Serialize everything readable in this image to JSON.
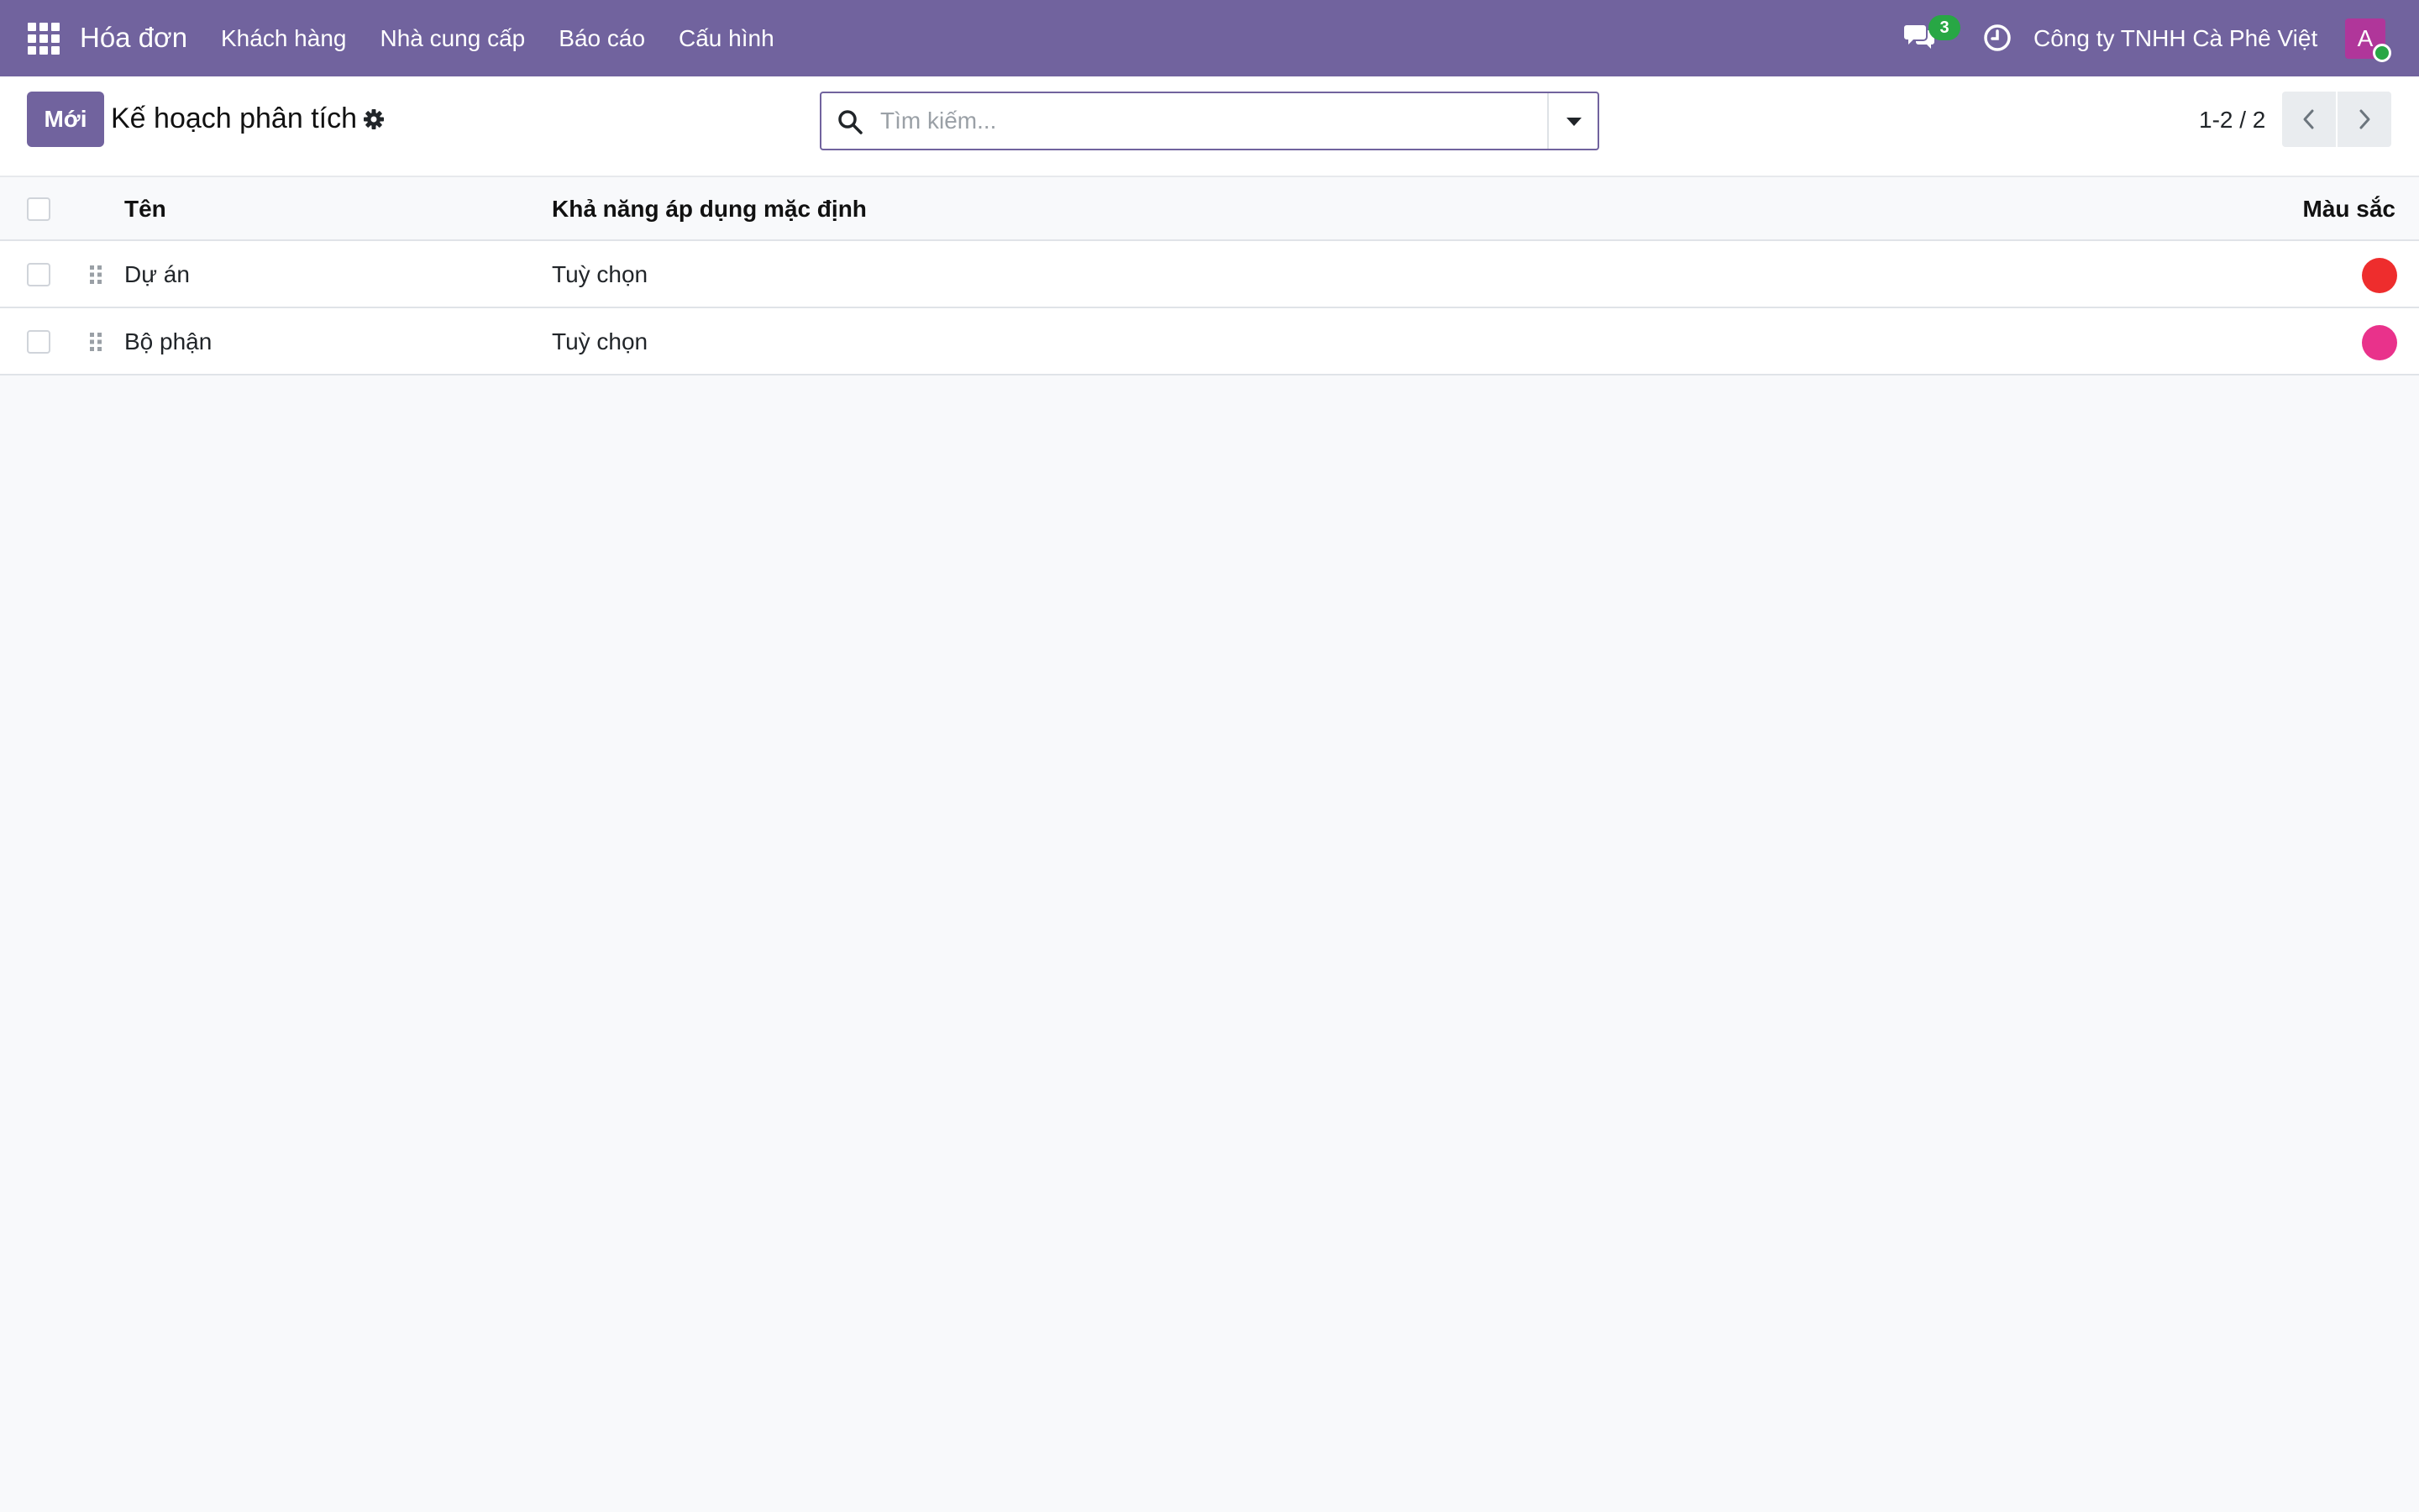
{
  "navbar": {
    "app_title": "Hóa đơn",
    "menu": [
      "Khách hàng",
      "Nhà cung cấp",
      "Báo cáo",
      "Cấu hình"
    ],
    "chat_count": "3",
    "company": "Công ty TNHH Cà Phê Việt",
    "avatar_letter": "A",
    "colors": {
      "navbar": "#71639e",
      "badge": "#28a745",
      "avatar": "#b0369a"
    }
  },
  "control": {
    "new_label": "Mới",
    "title": "Kế hoạch phân tích",
    "search_placeholder": "Tìm kiếm...",
    "pager": "1-2 / 2"
  },
  "table": {
    "headers": {
      "name": "Tên",
      "applicability": "Khả năng áp dụng mặc định",
      "color": "Màu sắc"
    },
    "rows": [
      {
        "name": "Dự án",
        "applicability": "Tuỳ chọn",
        "color": "#ee2d2d"
      },
      {
        "name": "Bộ phận",
        "applicability": "Tuỳ chọn",
        "color": "#e9328b"
      }
    ]
  }
}
